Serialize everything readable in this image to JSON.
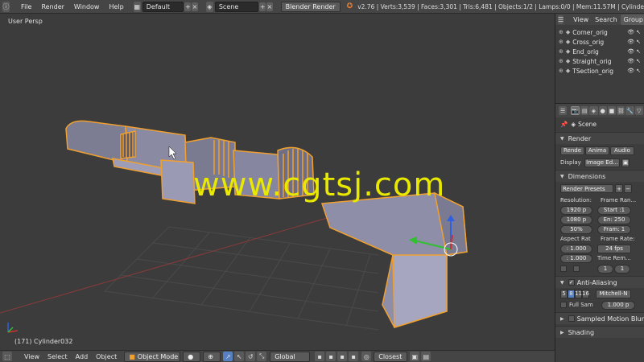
{
  "topbar": {
    "menus": [
      "File",
      "Render",
      "Window",
      "Help"
    ],
    "layout": "Default",
    "scene": "Scene",
    "engine": "Blender Render",
    "stats": "v2.76 | Verts:3,539 | Faces:3,301 | Tris:6,481 | Objects:1/2 | Lamps:0/0 | Mem:11.57M | Cylinde"
  },
  "viewport": {
    "view_name": "User Persp",
    "object_label": "(171) Cylinder032",
    "watermark": "www.cgtsj.com"
  },
  "bottombar": {
    "menus": [
      "View",
      "Select",
      "Add",
      "Object"
    ],
    "mode": "Object Mode",
    "orientation": "Global",
    "pivot": "Closest"
  },
  "outliner": {
    "tabs": [
      "View",
      "Search",
      "Group"
    ],
    "items": [
      "Corner_orig",
      "Cross_orig",
      "End_orig",
      "Straight_orig",
      "TSection_orig"
    ]
  },
  "properties": {
    "context": "Scene",
    "render_panel": "Render",
    "render_buttons": [
      "Rende",
      "Anima",
      "Audio"
    ],
    "display_label": "Display",
    "display_value": "Image Ed...",
    "dimensions_panel": "Dimensions",
    "presets": "Render Presets",
    "resolution_label": "Resolution:",
    "res_x": "1920 p",
    "res_y": "1080 p",
    "res_pct": "50%",
    "frame_range_label": "Frame Ran...",
    "frame_start": "Start :1",
    "frame_end": "En: 250",
    "frame_step": "Fram: 1",
    "aspect_label": "Aspect Rat",
    "aspect_x": ": 1.000",
    "aspect_y": ": 1.000",
    "frame_rate_label": "Frame Rate:",
    "fps": "24 fps",
    "time_remap_label": "Time Rem...",
    "remap_old": "1",
    "remap_new": "1",
    "aa_panel": "Anti-Aliasing",
    "aa_samples": [
      "5",
      "8",
      "11",
      "16"
    ],
    "aa_filter": "Mitchell-N",
    "full_sample": "Full Sam",
    "filter_size": "1.000 p",
    "motion_blur_panel": "Sampled Motion Blur",
    "shading_panel": "Shading"
  },
  "colors": {
    "selection": "#f0a030",
    "watermark": "#e8e800"
  }
}
